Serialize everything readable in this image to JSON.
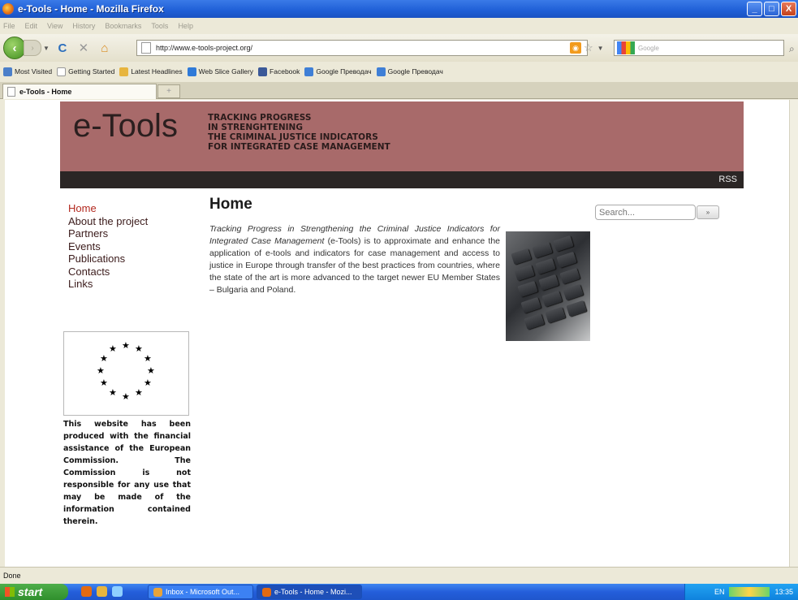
{
  "window": {
    "title": "e-Tools - Home - Mozilla Firefox",
    "controls": [
      "_",
      "□",
      "X"
    ]
  },
  "menu": [
    "File",
    "Edit",
    "View",
    "History",
    "Bookmarks",
    "Tools",
    "Help"
  ],
  "toolbar": {
    "url": "http://www.e-tools-project.org/",
    "search_placeholder": "Google",
    "back_icon": "back-arrow-icon",
    "reload_icon": "reload-icon",
    "stop_icon": "stop-icon",
    "home_icon": "home-icon"
  },
  "bookmarks": [
    "Most Visited",
    "Getting Started",
    "Latest Headlines",
    "Web Slice Gallery",
    "Facebook",
    "Google Преводач",
    "Google Преводач"
  ],
  "tab": {
    "title": "e-Tools - Home",
    "new_tab": "+"
  },
  "site": {
    "logo": "e-Tools",
    "tagline": [
      "TRACKING PROGRESS",
      "IN STRENGHTENING",
      "THE CRIMINAL JUSTICE INDICATORS",
      "FOR INTEGRATED CASE MANAGEMENT"
    ],
    "rss": "RSS",
    "nav": [
      "Home",
      "About the project",
      "Partners",
      "Events",
      "Publications",
      "Contacts",
      "Links"
    ],
    "search_placeholder": "Search...",
    "search_button": "»",
    "page_title": "Home",
    "intro_italic": "Tracking Progress in Strengthening the Criminal Justice Indicators for Integrated Case Management",
    "intro_rest": " (e-Tools) is to approximate and enhance the application of e-tools and indicators for case management and access to justice in Europe through transfer of the best practices from countries, where the state of the art is more advanced to the target newer EU Member States – Bulgaria and Poland.",
    "disclaimer": "This website has been produced with the financial assistance of the European Commission. The Commission is not responsible for any use that may be made of the information contained therein.",
    "colors": {
      "banner": "#a86a6a",
      "dark_bar": "#2b2625",
      "active_nav": "#b3291f",
      "nav": "#3b1b1b"
    }
  },
  "status": "Done",
  "taskbar": {
    "start": "start",
    "items": [
      "Inbox - Microsoft Out...",
      "e-Tools - Home - Mozi..."
    ],
    "lang": "EN",
    "clock": "13:35"
  }
}
